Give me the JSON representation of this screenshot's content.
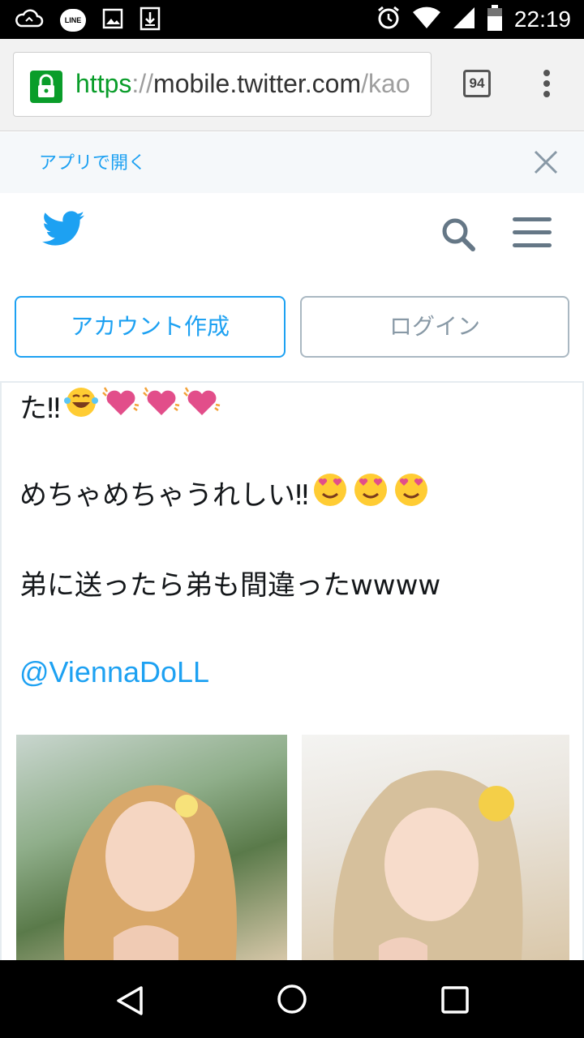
{
  "status_bar": {
    "time": "22:19",
    "line_label": "LINE",
    "icons": [
      "cloud-sync-icon",
      "line-icon",
      "image-icon",
      "download-icon",
      "alarm-icon",
      "wifi-icon",
      "signal-icon",
      "battery-icon"
    ]
  },
  "browser": {
    "url_scheme": "https",
    "url_sep": "://",
    "url_host": "mobile.twitter.com",
    "url_rest": "/kao",
    "tab_count": "94",
    "colors": {
      "secure": "#0a9d2a"
    }
  },
  "banner": {
    "open_app": "アプリで開く"
  },
  "twitter_nav": {
    "colors": {
      "brand": "#1da1f2"
    }
  },
  "auth": {
    "signup": "アカウント作成",
    "login": "ログイン"
  },
  "tweet": {
    "line1": "た‼",
    "line2": "めちゃめちゃうれしい‼",
    "line3": "弟に送ったら弟も間違ったwwww",
    "mention": "@ViennaDoLL",
    "emoji": {
      "line1": [
        "grinning-tears-emoji",
        "beating-heart-emoji",
        "beating-heart-emoji",
        "beating-heart-emoji"
      ],
      "line2": [
        "heart-eyes-emoji",
        "heart-eyes-emoji",
        "heart-eyes-emoji"
      ]
    }
  }
}
